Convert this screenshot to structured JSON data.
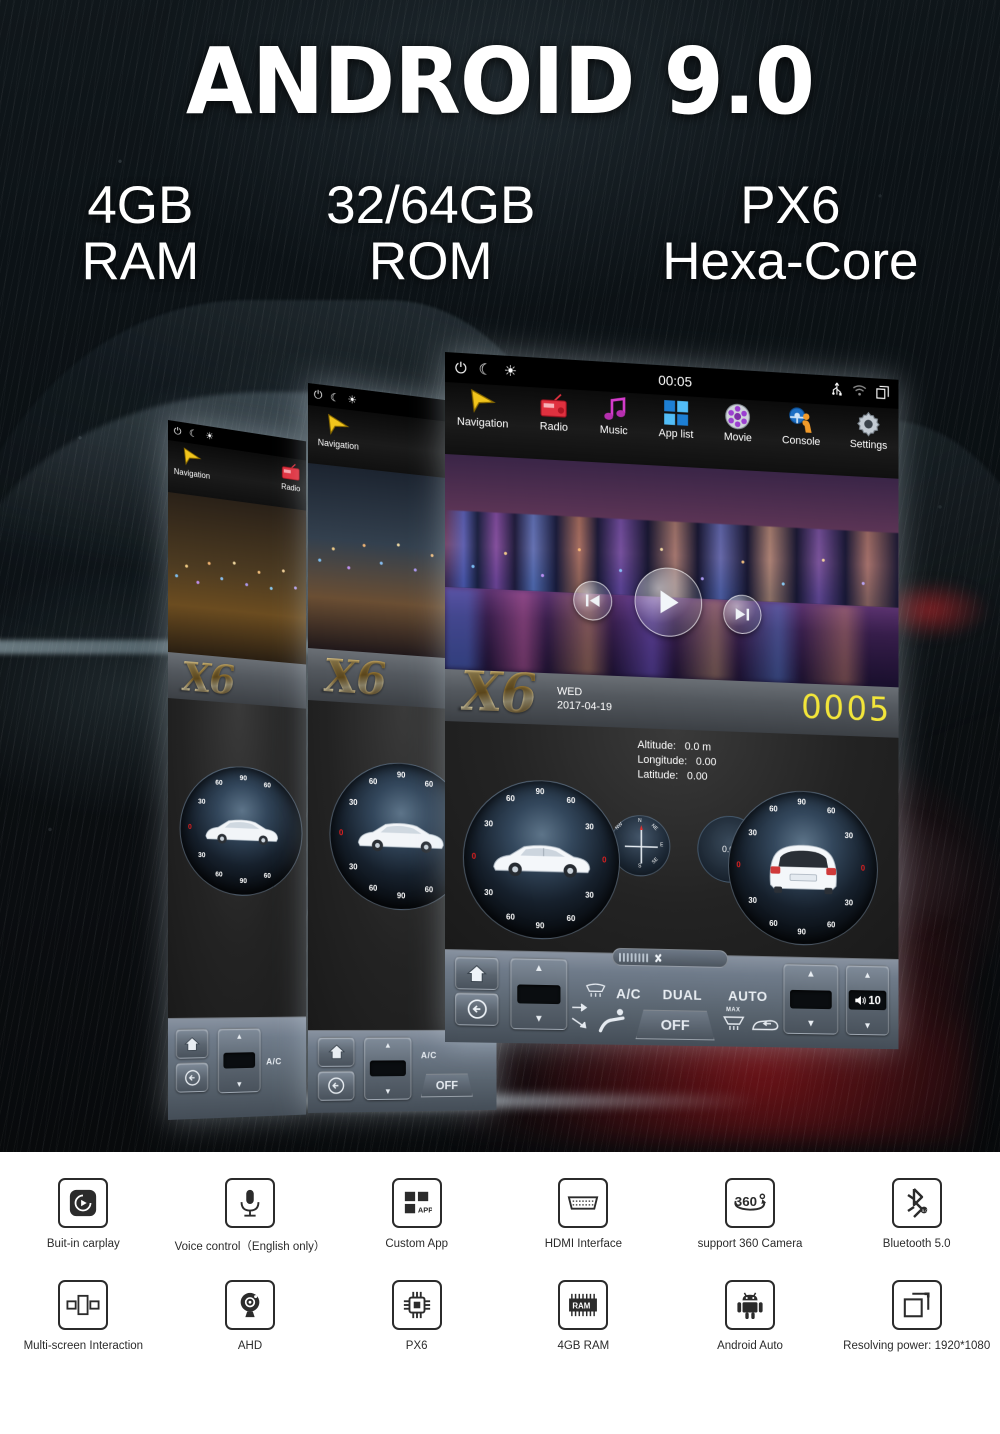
{
  "hero": {
    "headline": "ANDROID 9.0",
    "specs": [
      {
        "line1": "4GB",
        "line2": "RAM"
      },
      {
        "line1": "32/64GB",
        "line2": "ROM"
      },
      {
        "line1": "PX6",
        "line2": "Hexa-Core"
      }
    ]
  },
  "head_unit": {
    "status_bar": {
      "power_icon": "power-icon",
      "night_icon": "moon-icon",
      "brightness_icon": "brightness-icon",
      "clock": "00:05",
      "usb_icon": "usb-icon",
      "wifi_icon": "wifi-icon",
      "recents_icon": "recent-apps-icon"
    },
    "apps": [
      {
        "label": "Navigation",
        "icon": "navigation-arrow-icon"
      },
      {
        "label": "Radio",
        "icon": "radio-icon"
      },
      {
        "label": "Music",
        "icon": "music-note-icon"
      },
      {
        "label": "App list",
        "icon": "app-grid-icon"
      },
      {
        "label": "Movie",
        "icon": "movie-reel-icon"
      },
      {
        "label": "Console",
        "icon": "steering-wheel-icon"
      },
      {
        "label": "Settings",
        "icon": "gear-icon"
      }
    ],
    "media": {
      "previous_icon": "skip-previous-icon",
      "play_icon": "play-icon",
      "next_icon": "skip-next-icon"
    },
    "info_bar": {
      "brand": "X6",
      "weekday": "WED",
      "date": "2017-04-19",
      "clock_hours": "00",
      "clock_minutes": "05"
    },
    "gps": {
      "altitude_label": "Altitude:",
      "altitude_value": "0.0 m",
      "longitude_label": "Longitude:",
      "longitude_value": "0.00",
      "latitude_label": "Latitude:",
      "latitude_value": "0.00"
    },
    "gauges": {
      "tick_labels": [
        "0",
        "30",
        "60",
        "90",
        "60",
        "30",
        "0",
        "30",
        "60",
        "90",
        "60",
        "30"
      ],
      "pitch_gauge_name": "pitch-inclinometer",
      "roll_gauge_name": "roll-inclinometer",
      "compass_points": [
        "N",
        "NE",
        "E",
        "SE",
        "S",
        "SW",
        "W",
        "NW"
      ],
      "altimeter_value": "0.0 m"
    },
    "climate": {
      "home_icon": "home-icon",
      "back_icon": "back-arrow-icon",
      "ac_label": "A/C",
      "dual_label": "DUAL",
      "auto_label": "AUTO",
      "off_label": "OFF",
      "max_label": "MAX",
      "front_defrost_icon": "front-defrost-icon",
      "rear_defrost_icon": "rear-defrost-icon",
      "recirculate_icon": "air-recirculate-icon",
      "airflow_icon": "airflow-direction-icon",
      "seat_icon": "seat-airflow-icon",
      "fan_icon": "fan-icon",
      "volume_icon": "volume-icon",
      "volume_value": "10",
      "temp_up_icon": "chevron-up-icon",
      "temp_down_icon": "chevron-down-icon"
    }
  },
  "features": {
    "row1": [
      {
        "label": "Buit-in carplay",
        "icon": "carplay-icon"
      },
      {
        "label": "Voice control（English only）",
        "icon": "microphone-icon"
      },
      {
        "label": "Custom App",
        "icon": "custom-app-icon"
      },
      {
        "label": "HDMI Interface",
        "icon": "hdmi-port-icon"
      },
      {
        "label": "support 360 Camera",
        "icon": "360-camera-icon"
      },
      {
        "label": "Bluetooth 5.0",
        "icon": "bluetooth-icon"
      }
    ],
    "row2": [
      {
        "label": "Multi-screen Interaction",
        "icon": "multi-screen-icon"
      },
      {
        "label": "AHD",
        "icon": "camera-icon"
      },
      {
        "label": "PX6",
        "icon": "cpu-chip-icon"
      },
      {
        "label": "4GB  RAM",
        "icon": "ram-chip-icon"
      },
      {
        "label": "Android Auto",
        "icon": "android-robot-icon"
      },
      {
        "label": "Resolving power: 1920*1080",
        "icon": "resolution-icon"
      }
    ]
  },
  "colors": {
    "accent_yellow": "#f2e53a",
    "brand_gold": "#d9bf7e",
    "radio_red": "#e0313f",
    "nav_yellow": "#f2c51c",
    "music_magenta": "#d43ccb",
    "applist_blue": "#2e9df5"
  }
}
